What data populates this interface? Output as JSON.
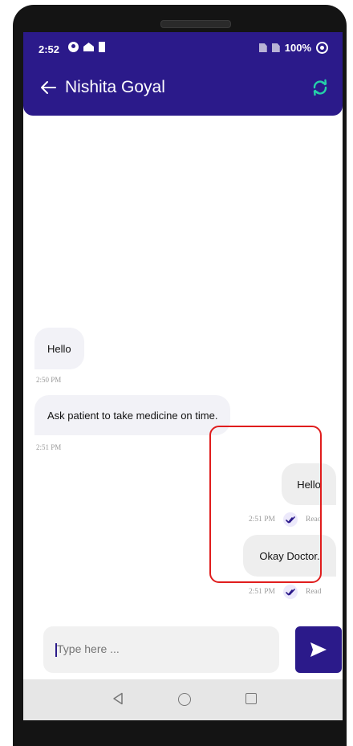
{
  "status_bar": {
    "time": "2:52",
    "battery": "100%"
  },
  "header": {
    "title": "Nishita Goyal",
    "back_icon": "arrow-left-icon",
    "refresh_icon": "refresh-icon",
    "bg_color": "#2b1a8a",
    "refresh_color": "#25d0a8"
  },
  "messages": [
    {
      "direction": "incoming",
      "text": "Hello",
      "time": "2:50 PM"
    },
    {
      "direction": "incoming",
      "text": "Ask patient to take medicine on time.",
      "time": "2:51 PM"
    },
    {
      "direction": "outgoing",
      "text": "Hello",
      "time": "2:51 PM",
      "status": "Read"
    },
    {
      "direction": "outgoing",
      "text": "Okay Doctor.",
      "time": "2:51 PM",
      "status": "Read"
    }
  ],
  "composer": {
    "placeholder": "Type here ...",
    "send_icon": "send-icon"
  },
  "nav_bar": {
    "back_icon": "triangle-back-icon",
    "home_icon": "circle-home-icon",
    "recents_icon": "square-recents-icon"
  }
}
